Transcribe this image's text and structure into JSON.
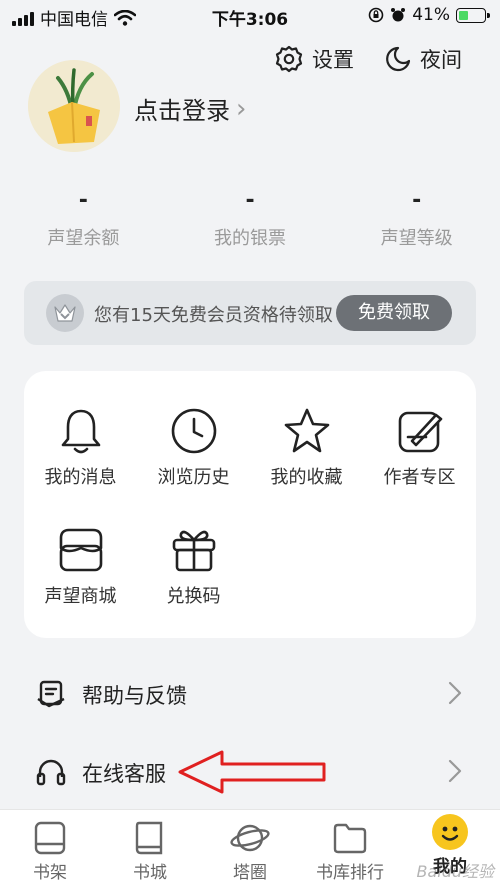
{
  "status_bar": {
    "carrier": "中国电信",
    "time": "下午3:06",
    "battery": "41%",
    "battery_level": 0.41
  },
  "header": {
    "settings_label": "设置",
    "night_label": "夜间"
  },
  "profile": {
    "login_label": "点击登录",
    "login_chevron": "›"
  },
  "stats": [
    {
      "value": "-",
      "label": "声望余额"
    },
    {
      "value": "-",
      "label": "我的银票"
    },
    {
      "value": "-",
      "label": "声望等级"
    }
  ],
  "member_banner": {
    "text": "您有15天免费会员资格待领取",
    "button": "免费领取"
  },
  "menu_grid": [
    {
      "label": "我的消息",
      "icon": "bell-icon"
    },
    {
      "label": "浏览历史",
      "icon": "clock-icon"
    },
    {
      "label": "我的收藏",
      "icon": "star-icon"
    },
    {
      "label": "作者专区",
      "icon": "pen-icon"
    },
    {
      "label": "声望商城",
      "icon": "store-icon"
    },
    {
      "label": "兑换码",
      "icon": "gift-icon"
    }
  ],
  "list_items": [
    {
      "label": "帮助与反馈",
      "icon": "help-icon"
    },
    {
      "label": "在线客服",
      "icon": "headset-icon"
    }
  ],
  "bottom_nav": [
    {
      "label": "书架",
      "icon": "bookshelf-icon"
    },
    {
      "label": "书城",
      "icon": "book-icon"
    },
    {
      "label": "塔圈",
      "icon": "planet-icon"
    },
    {
      "label": "书库排行",
      "icon": "folder-icon"
    },
    {
      "label": "我的",
      "icon": "smiley-icon",
      "active": true
    }
  ],
  "watermark": "Baidu经验",
  "colors": {
    "background": "#f2f3f5",
    "annotation_arrow": "#e02020",
    "avatar_yellow": "#f5c542",
    "member_button": "#6d7176"
  }
}
